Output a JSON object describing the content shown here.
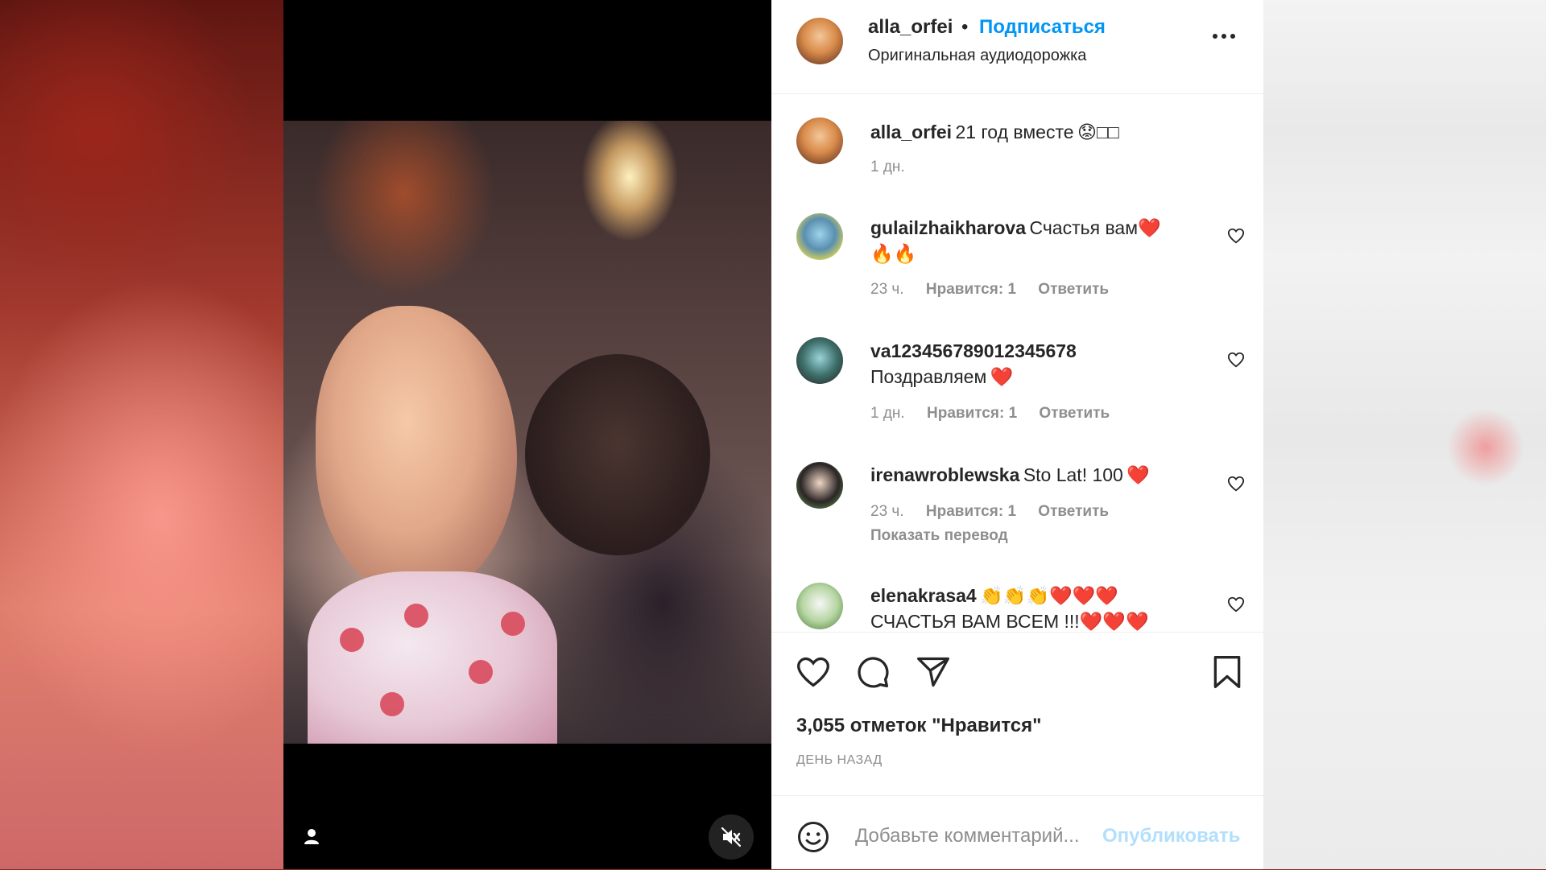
{
  "post": {
    "username": "alla_orfei",
    "separator": "•",
    "follow_label": "Подписаться",
    "audio_label": "Оригинальная аудиодорожка",
    "caption": {
      "username": "alla_orfei",
      "text": "21 год вместе",
      "emoji": "😟",
      "trailing": "□□",
      "time": "1 дн."
    }
  },
  "comments": [
    {
      "username": "gulailzhaikharova",
      "text_line1": "Счастья вам",
      "emoji_line1": "❤️",
      "text_line2": "🔥🔥",
      "time": "23 ч.",
      "likes": "Нравится: 1",
      "reply": "Ответить"
    },
    {
      "username": "va12345678901234567​8",
      "text_line2": "Поздравляем",
      "emoji_line2": "❤️",
      "time": "1 дн.",
      "likes": "Нравится: 1",
      "reply": "Ответить"
    },
    {
      "username": "irenawroblewska",
      "text_line1": "Sto Lat! 100",
      "emoji_line1": "❤️",
      "time": "23 ч.",
      "likes": "Нравится: 1",
      "reply": "Ответить",
      "translate": "Показать перевод"
    },
    {
      "username": "elenakrasa4",
      "emoji_line1": "👏👏👏❤️❤️❤️",
      "text_line2": "СЧАСТЬЯ ВАМ ВСЕМ !!!",
      "emoji_line2": "❤️❤️❤️"
    }
  ],
  "stats": {
    "likes": "3,055 отметок \"Нравится\"",
    "posted": "ДЕНЬ НАЗАД"
  },
  "composer": {
    "placeholder": "Добавьте комментарий...",
    "post_label": "Опубликовать"
  },
  "icons": [
    "heart-icon",
    "comment-icon",
    "share-icon",
    "bookmark-icon",
    "emoji-icon",
    "more-icon",
    "mute-icon",
    "user-tag-icon"
  ],
  "colors": {
    "link_blue": "#0095f6",
    "disabled_blue": "#b2dffc",
    "meta_gray": "#8e8e8e",
    "text": "#262626"
  }
}
